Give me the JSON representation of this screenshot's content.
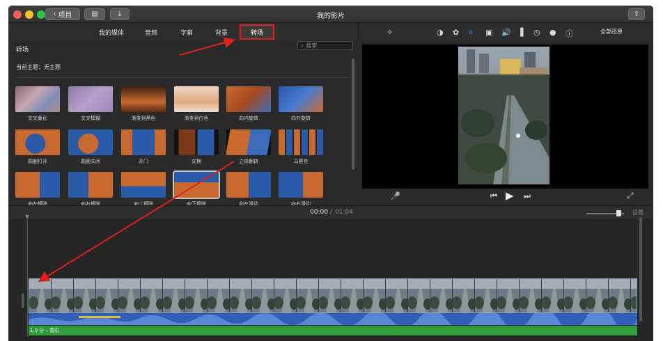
{
  "window": {
    "title": "我的影片",
    "back_button": "项目"
  },
  "browser": {
    "tabs": [
      "我的媒体",
      "音频",
      "字幕",
      "背景"
    ],
    "active_tab": "转场",
    "pane_title": "转场",
    "search_placeholder": "搜索",
    "current_theme": "当前主题：无主题",
    "transitions": [
      "交叉叠化",
      "交叉模糊",
      "渐变到黑色",
      "渐变到白色",
      "向内旋转",
      "向外旋转",
      "圆圈打开",
      "圆圈关闭",
      "开门",
      "交换",
      "立体翻转",
      "马赛克",
      "向左擦除",
      "向右擦除",
      "向上擦除",
      "向下擦除",
      "向左滑动",
      "向右滑动"
    ]
  },
  "viewer": {
    "reset_all": "全部还原"
  },
  "timeline": {
    "current_time": "00:00",
    "separator": "/",
    "total_time": "01:04",
    "settings": "设置",
    "music_label": "1.0 分 – 霓虹"
  },
  "colors": {
    "highlight_red": "#e02020",
    "audio_blue": "#2f5fb8",
    "music_green": "#2f9e3a"
  }
}
